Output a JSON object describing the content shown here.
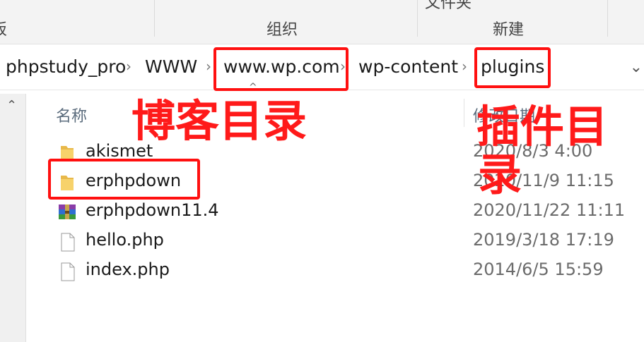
{
  "ribbon": {
    "left_fragment": "板",
    "top_fragment": "文件夹",
    "group_organize": "组织",
    "group_new": "新建"
  },
  "breadcrumb": {
    "items": [
      "phpstudy_pro",
      "WWW",
      "www.wp.com",
      "wp-content",
      "plugins"
    ]
  },
  "columns": {
    "name": "名称",
    "date_modified": "修改日期"
  },
  "files": [
    {
      "name": "akismet",
      "date": "2020/8/3 4:00",
      "icon": "folder-icon"
    },
    {
      "name": "erphpdown",
      "date": "2020/11/9 11:15",
      "icon": "folder-icon"
    },
    {
      "name": "erphpdown11.4",
      "date": "2020/11/22 11:11",
      "icon": "archive-icon"
    },
    {
      "name": "hello.php",
      "date": "2019/3/18 17:19",
      "icon": "file-icon"
    },
    {
      "name": "index.php",
      "date": "2014/6/5 15:59",
      "icon": "file-icon"
    }
  ],
  "annotations": {
    "blog_dir": "博客目录",
    "plugin_dir_line1": "插件目",
    "plugin_dir_line2": "录",
    "color": "#ff1010"
  }
}
